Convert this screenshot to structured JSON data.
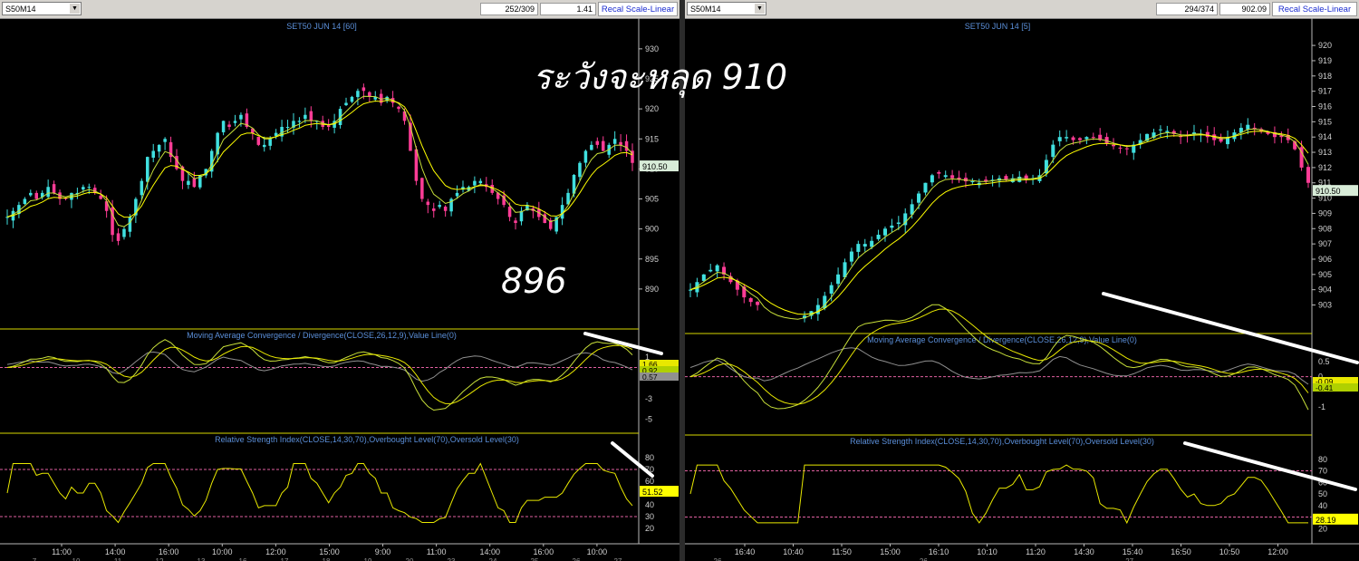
{
  "colors": {
    "background": "#000000",
    "axis": "#b8b8b8",
    "border": "#d8d800",
    "macd_line": "#c8e03a",
    "signal_line": "#e8e800",
    "histogram": "#909090",
    "rsi_line": "#e8e800",
    "ref_line": "#e060a0",
    "title_text": "#5b8fd9",
    "candle_up": "#40e0e0",
    "candle_down": "#ff3c96",
    "ma_fast": "#c8e03a",
    "ma_slow": "#ffff00"
  },
  "annotations": {
    "warning": "ระวังจะหลุด 910",
    "support": "896"
  },
  "left": {
    "symbol": "S50M14",
    "bars": "252/309",
    "scale_value": "1.41",
    "button": "Recal Scale-Linear",
    "price_title": "SET50 JUN 14  [60]",
    "macd_title": "Moving Average Convergence / Divergence(CLOSE,26,12,9),Value Line(0)",
    "rsi_title": "Relative Strength Index(CLOSE,14,30,70),Overbought Level(70),Oversold Level(30)",
    "price_ticks": [
      "930",
      "925",
      "920",
      "915",
      "910",
      "905",
      "900",
      "895",
      "890"
    ],
    "price_label": "910.50",
    "macd_ticks": [
      "1",
      "-1",
      "-3",
      "-5"
    ],
    "macd_labels": [
      "1.66",
      "0.92",
      "0.57"
    ],
    "rsi_ticks": [
      "80",
      "70",
      "60",
      "50",
      "40",
      "30",
      "20"
    ],
    "rsi_label": "51.52",
    "time_ticks": [
      "11:00",
      "14:00",
      "16:00",
      "10:00",
      "12:00",
      "15:00",
      "9:00",
      "11:00",
      "14:00",
      "16:00",
      "10:00"
    ],
    "date_ticks": [
      "7",
      "10",
      "11",
      "12",
      "13",
      "16",
      "17",
      "18",
      "19",
      "20",
      "23",
      "24",
      "25",
      "26",
      "27"
    ]
  },
  "right": {
    "symbol": "S50M14",
    "bars": "294/374",
    "scale_value": "902.09",
    "button": "Recal Scale-Linear",
    "price_title": "SET50 JUN 14  [5]",
    "macd_title": "Moving Average Convergence / Divergence(CLOSE,26,12,9),Value Line(0)",
    "rsi_title": "Relative Strength Index(CLOSE,14,30,70),Overbought Level(70),Oversold Level(30)",
    "price_ticks": [
      "920",
      "919",
      "918",
      "917",
      "916",
      "915",
      "914",
      "913",
      "912",
      "911",
      "910",
      "909",
      "908",
      "907",
      "906",
      "905",
      "904",
      "903"
    ],
    "price_label": "910.50",
    "macd_ticks": [
      "0.5",
      "0",
      "-1"
    ],
    "macd_labels": [
      "-0.09",
      "-0.41"
    ],
    "rsi_ticks": [
      "80",
      "70",
      "60",
      "50",
      "40",
      "30",
      "20"
    ],
    "rsi_label": "28.19",
    "time_ticks": [
      "16:40",
      "10:40",
      "11:50",
      "15:00",
      "16:10",
      "10:10",
      "11:20",
      "14:30",
      "15:40",
      "16:50",
      "10:50",
      "12:00"
    ],
    "date_ticks": [
      "26",
      "26",
      "27"
    ]
  },
  "chart_data": [
    {
      "type": "candlestick",
      "title": "SET50 JUN 14  [60]",
      "ylim": [
        885,
        933
      ],
      "close": [
        902,
        903,
        904,
        905,
        906,
        905,
        906,
        907,
        906,
        905,
        905,
        906,
        906,
        907,
        907,
        906,
        905,
        903,
        899,
        898,
        900,
        902,
        905,
        908,
        912,
        913,
        914,
        915,
        912,
        910,
        908,
        908,
        907,
        909,
        910,
        913,
        916,
        918,
        917,
        918,
        919,
        917,
        916,
        914,
        914,
        915,
        916,
        917,
        917,
        918,
        918,
        919,
        918,
        918,
        917,
        917,
        918,
        920,
        921,
        922,
        923,
        923,
        922,
        922,
        921,
        922,
        921,
        920,
        918,
        913,
        908,
        905,
        904,
        903,
        904,
        903,
        905,
        906,
        907,
        907,
        908,
        908,
        907,
        906,
        905,
        904,
        902,
        901,
        903,
        904,
        903,
        902,
        901,
        900,
        902,
        904,
        906,
        909,
        911,
        913,
        914,
        914,
        913,
        914,
        915,
        914,
        913,
        911
      ],
      "last": "910.50"
    },
    {
      "type": "candlestick",
      "title": "SET50 JUN 14  [5]",
      "ylim": [
        902.2,
        920.6
      ],
      "close": [
        904,
        904.5,
        905,
        905.3,
        905.6,
        905,
        904.5,
        904,
        903.5,
        903.2,
        903,
        902,
        902,
        902,
        902,
        902,
        902,
        902.3,
        902.6,
        903,
        903.6,
        904.3,
        905,
        905.8,
        906.5,
        907,
        907,
        907.2,
        907.6,
        908,
        908.2,
        908.4,
        909,
        909.6,
        910.3,
        911,
        911.5,
        911.6,
        911.5,
        911.3,
        911.2,
        911.1,
        911.1,
        911,
        911.1,
        911.2,
        911.3,
        911.2,
        911.3,
        911.4,
        911.2,
        911.3,
        911.5,
        912.5,
        913.5,
        914,
        914,
        913.8,
        913.8,
        914,
        914,
        913.8,
        913.6,
        913.4,
        913.3,
        913.2,
        913.5,
        913.8,
        914.2,
        914.3,
        914.5,
        914.4,
        914.2,
        914,
        914.1,
        914.3,
        914.2,
        914,
        913.8,
        913.7,
        914,
        914.3,
        914.6,
        914.8,
        914.6,
        914.4,
        914.2,
        914,
        914,
        913.8,
        913.2,
        912,
        911
      ],
      "last": "910.50"
    },
    {
      "type": "line",
      "title": "Moving Average Convergence / Divergence(CLOSE,26,12,9),Value Line(0)",
      "panel": "left",
      "series_names": [
        "MACD",
        "Signal",
        "Histogram"
      ],
      "last_values": [
        1.66,
        0.92,
        0.57
      ],
      "ylim": [
        -6,
        2.5
      ]
    },
    {
      "type": "line",
      "title": "Relative Strength Index(CLOSE,14,30,70),Overbought Level(70),Oversold Level(30)",
      "panel": "left",
      "levels": [
        70,
        30
      ],
      "last": 51.52,
      "ylim": [
        10,
        90
      ]
    },
    {
      "type": "line",
      "title": "Moving Average Convergence / Divergence(CLOSE,26,12,9),Value Line(0)",
      "panel": "right",
      "last_values": [
        -0.09,
        -0.41
      ],
      "ylim": [
        -1.8,
        1.0
      ]
    },
    {
      "type": "line",
      "title": "Relative Strength Index(CLOSE,14,30,70),Overbought Level(70),Oversold Level(30)",
      "panel": "right",
      "levels": [
        70,
        30
      ],
      "last": 28.19,
      "ylim": [
        10,
        90
      ]
    }
  ]
}
